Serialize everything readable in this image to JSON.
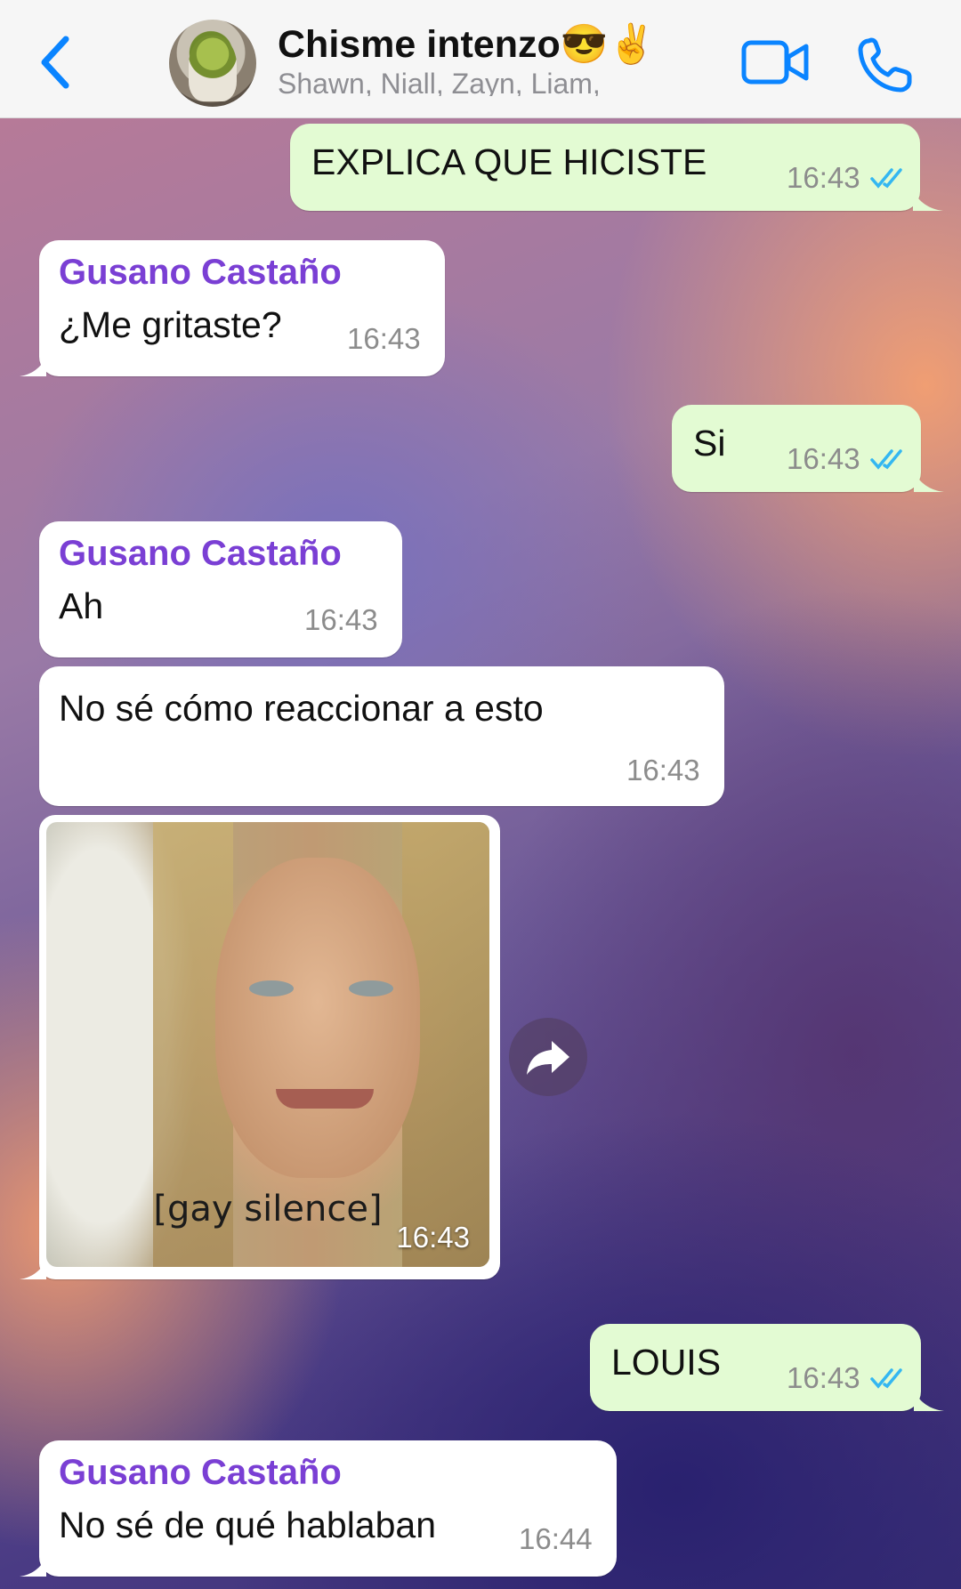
{
  "header": {
    "title": "Chisme intenzo😎✌️",
    "subtitle": "Shawn, Niall, Zayn, Liam,"
  },
  "messages": [
    {
      "type": "outgoing",
      "text": "EXPLICA QUE HICISTE",
      "time": "16:43"
    },
    {
      "type": "incoming",
      "sender": "Gusano Castaño",
      "text": "¿Me gritaste?",
      "time": "16:43"
    },
    {
      "type": "outgoing",
      "text": "Si",
      "time": "16:43"
    },
    {
      "type": "incoming",
      "sender": "Gusano Castaño",
      "text": "Ah",
      "time": "16:43"
    },
    {
      "type": "incoming",
      "text": "No sé cómo reaccionar a esto",
      "time": "16:43"
    },
    {
      "type": "incoming-media",
      "caption": "[gay silence]",
      "time": "16:43"
    },
    {
      "type": "outgoing",
      "text": "LOUIS",
      "time": "16:43"
    },
    {
      "type": "incoming",
      "sender": "Gusano Castaño",
      "text": "No sé de qué hablaban",
      "time": "16:44"
    }
  ],
  "icons": {
    "back": "chevron-left-icon",
    "video": "video-camera-icon",
    "call": "phone-icon",
    "forward": "forward-arrow-icon",
    "read_receipt": "double-check-icon"
  },
  "colors": {
    "accent": "#0a84ff",
    "sender_name": "#7a3fd4",
    "outgoing_bubble": "#e3fbd3",
    "incoming_bubble": "#ffffff",
    "read_ticks": "#34b7f1"
  }
}
